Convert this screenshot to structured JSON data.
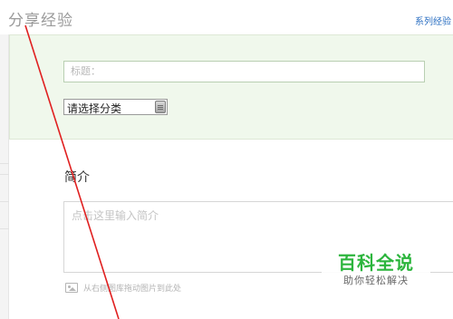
{
  "header": {
    "title": "分享经验",
    "series_link": "系列经验"
  },
  "form": {
    "title_placeholder": "标题：",
    "category_selected": "请选择分类"
  },
  "intro": {
    "heading": "简介",
    "placeholder": "点击这里输入简介",
    "drag_hint": "从右侧图库拖动图片到此处"
  },
  "watermark": {
    "brand": "百科全说",
    "slogan": "助你轻松解决"
  },
  "colors": {
    "panel_background": "#f0f8ec",
    "annotation_line": "#e02020",
    "watermark_brand": "#2cb53d",
    "link": "#2b6fc2"
  },
  "icons": {
    "select_arrow": "scroll-arrow-icon",
    "image": "image-icon"
  }
}
